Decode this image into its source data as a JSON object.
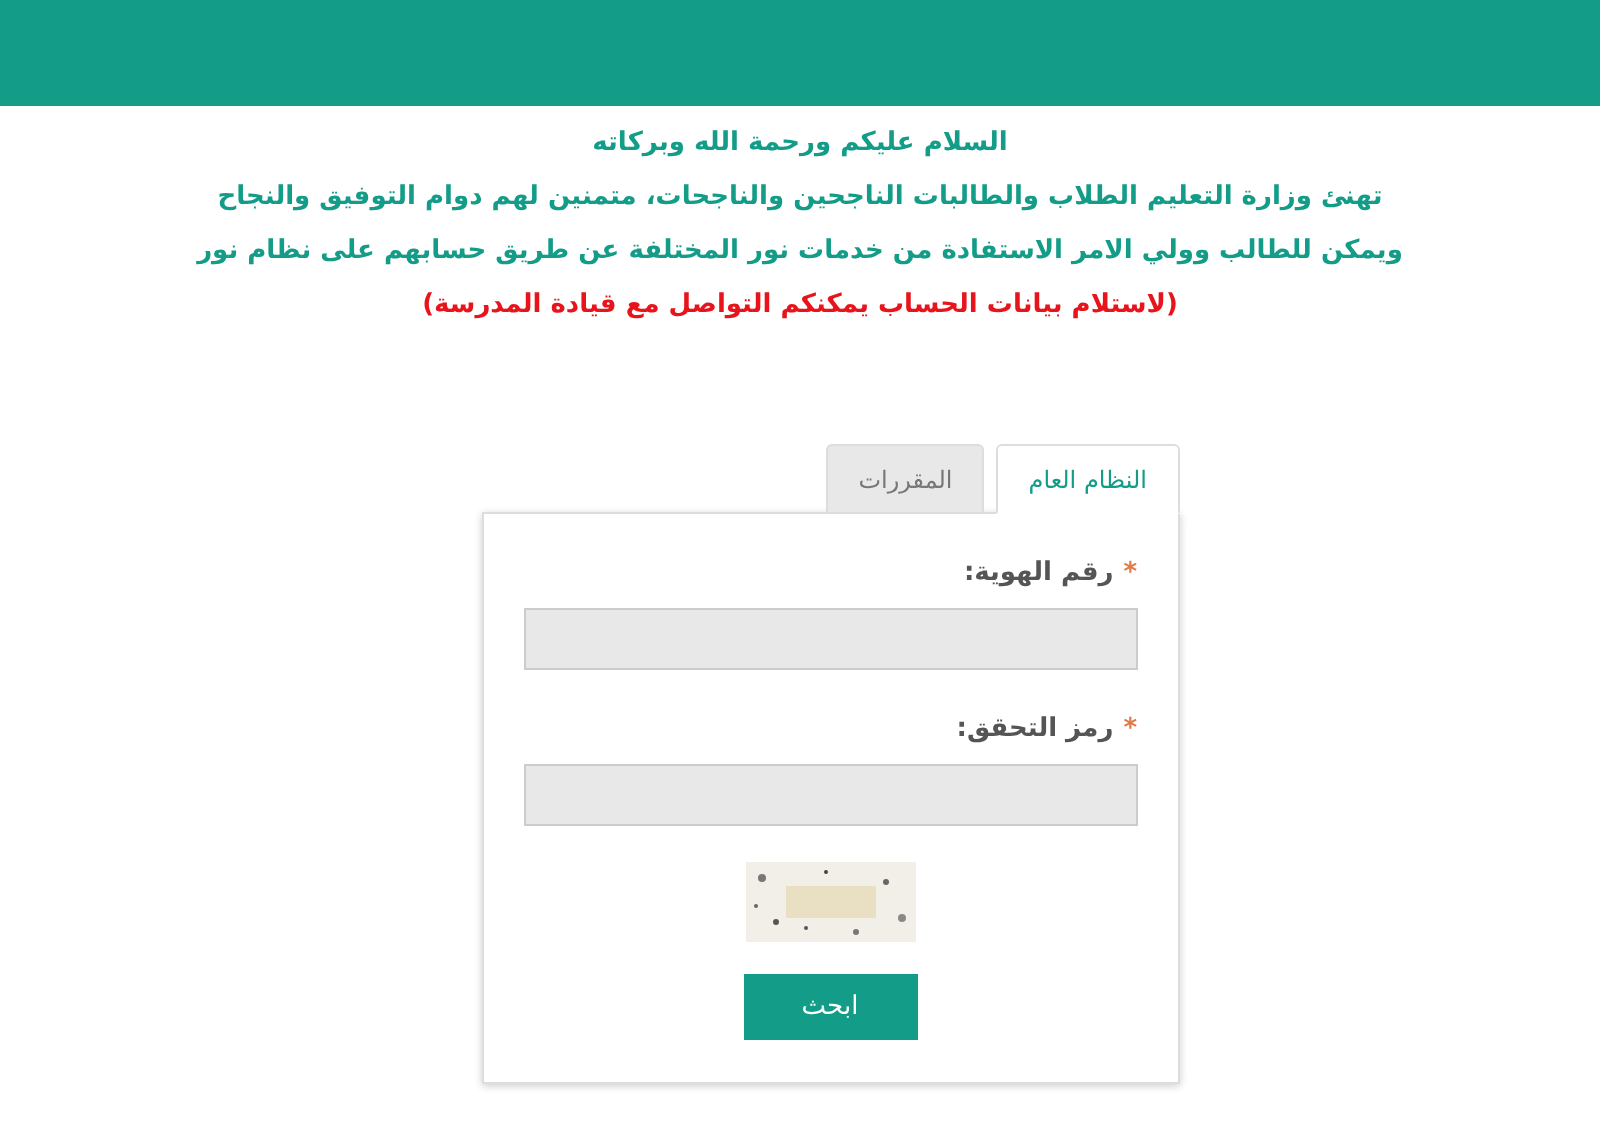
{
  "messages": [
    {
      "text": "السلام عليكم ورحمة الله وبركاته",
      "kind": "info"
    },
    {
      "text": "تهنئ وزارة التعليم الطلاب والطالبات الناجحين والناجحات، متمنين لهم دوام التوفيق والنجاح",
      "kind": "info"
    },
    {
      "text": "ويمكن للطالب وولي الامر الاستفادة من خدمات نور المختلفة عن طريق حسابهم على نظام نور",
      "kind": "info"
    },
    {
      "text": "(لاستلام بيانات الحساب يمكنكم التواصل مع قيادة المدرسة)",
      "kind": "alert"
    }
  ],
  "tabs": [
    {
      "label": "النظام العام",
      "selected": true
    },
    {
      "label": "المقررات",
      "selected": false
    }
  ],
  "fields": [
    {
      "label": "رقم الهوية:",
      "required_mark": "*"
    },
    {
      "label": "رمز التحقق:",
      "required_mark": "*"
    }
  ],
  "submit_button": "ابحث"
}
